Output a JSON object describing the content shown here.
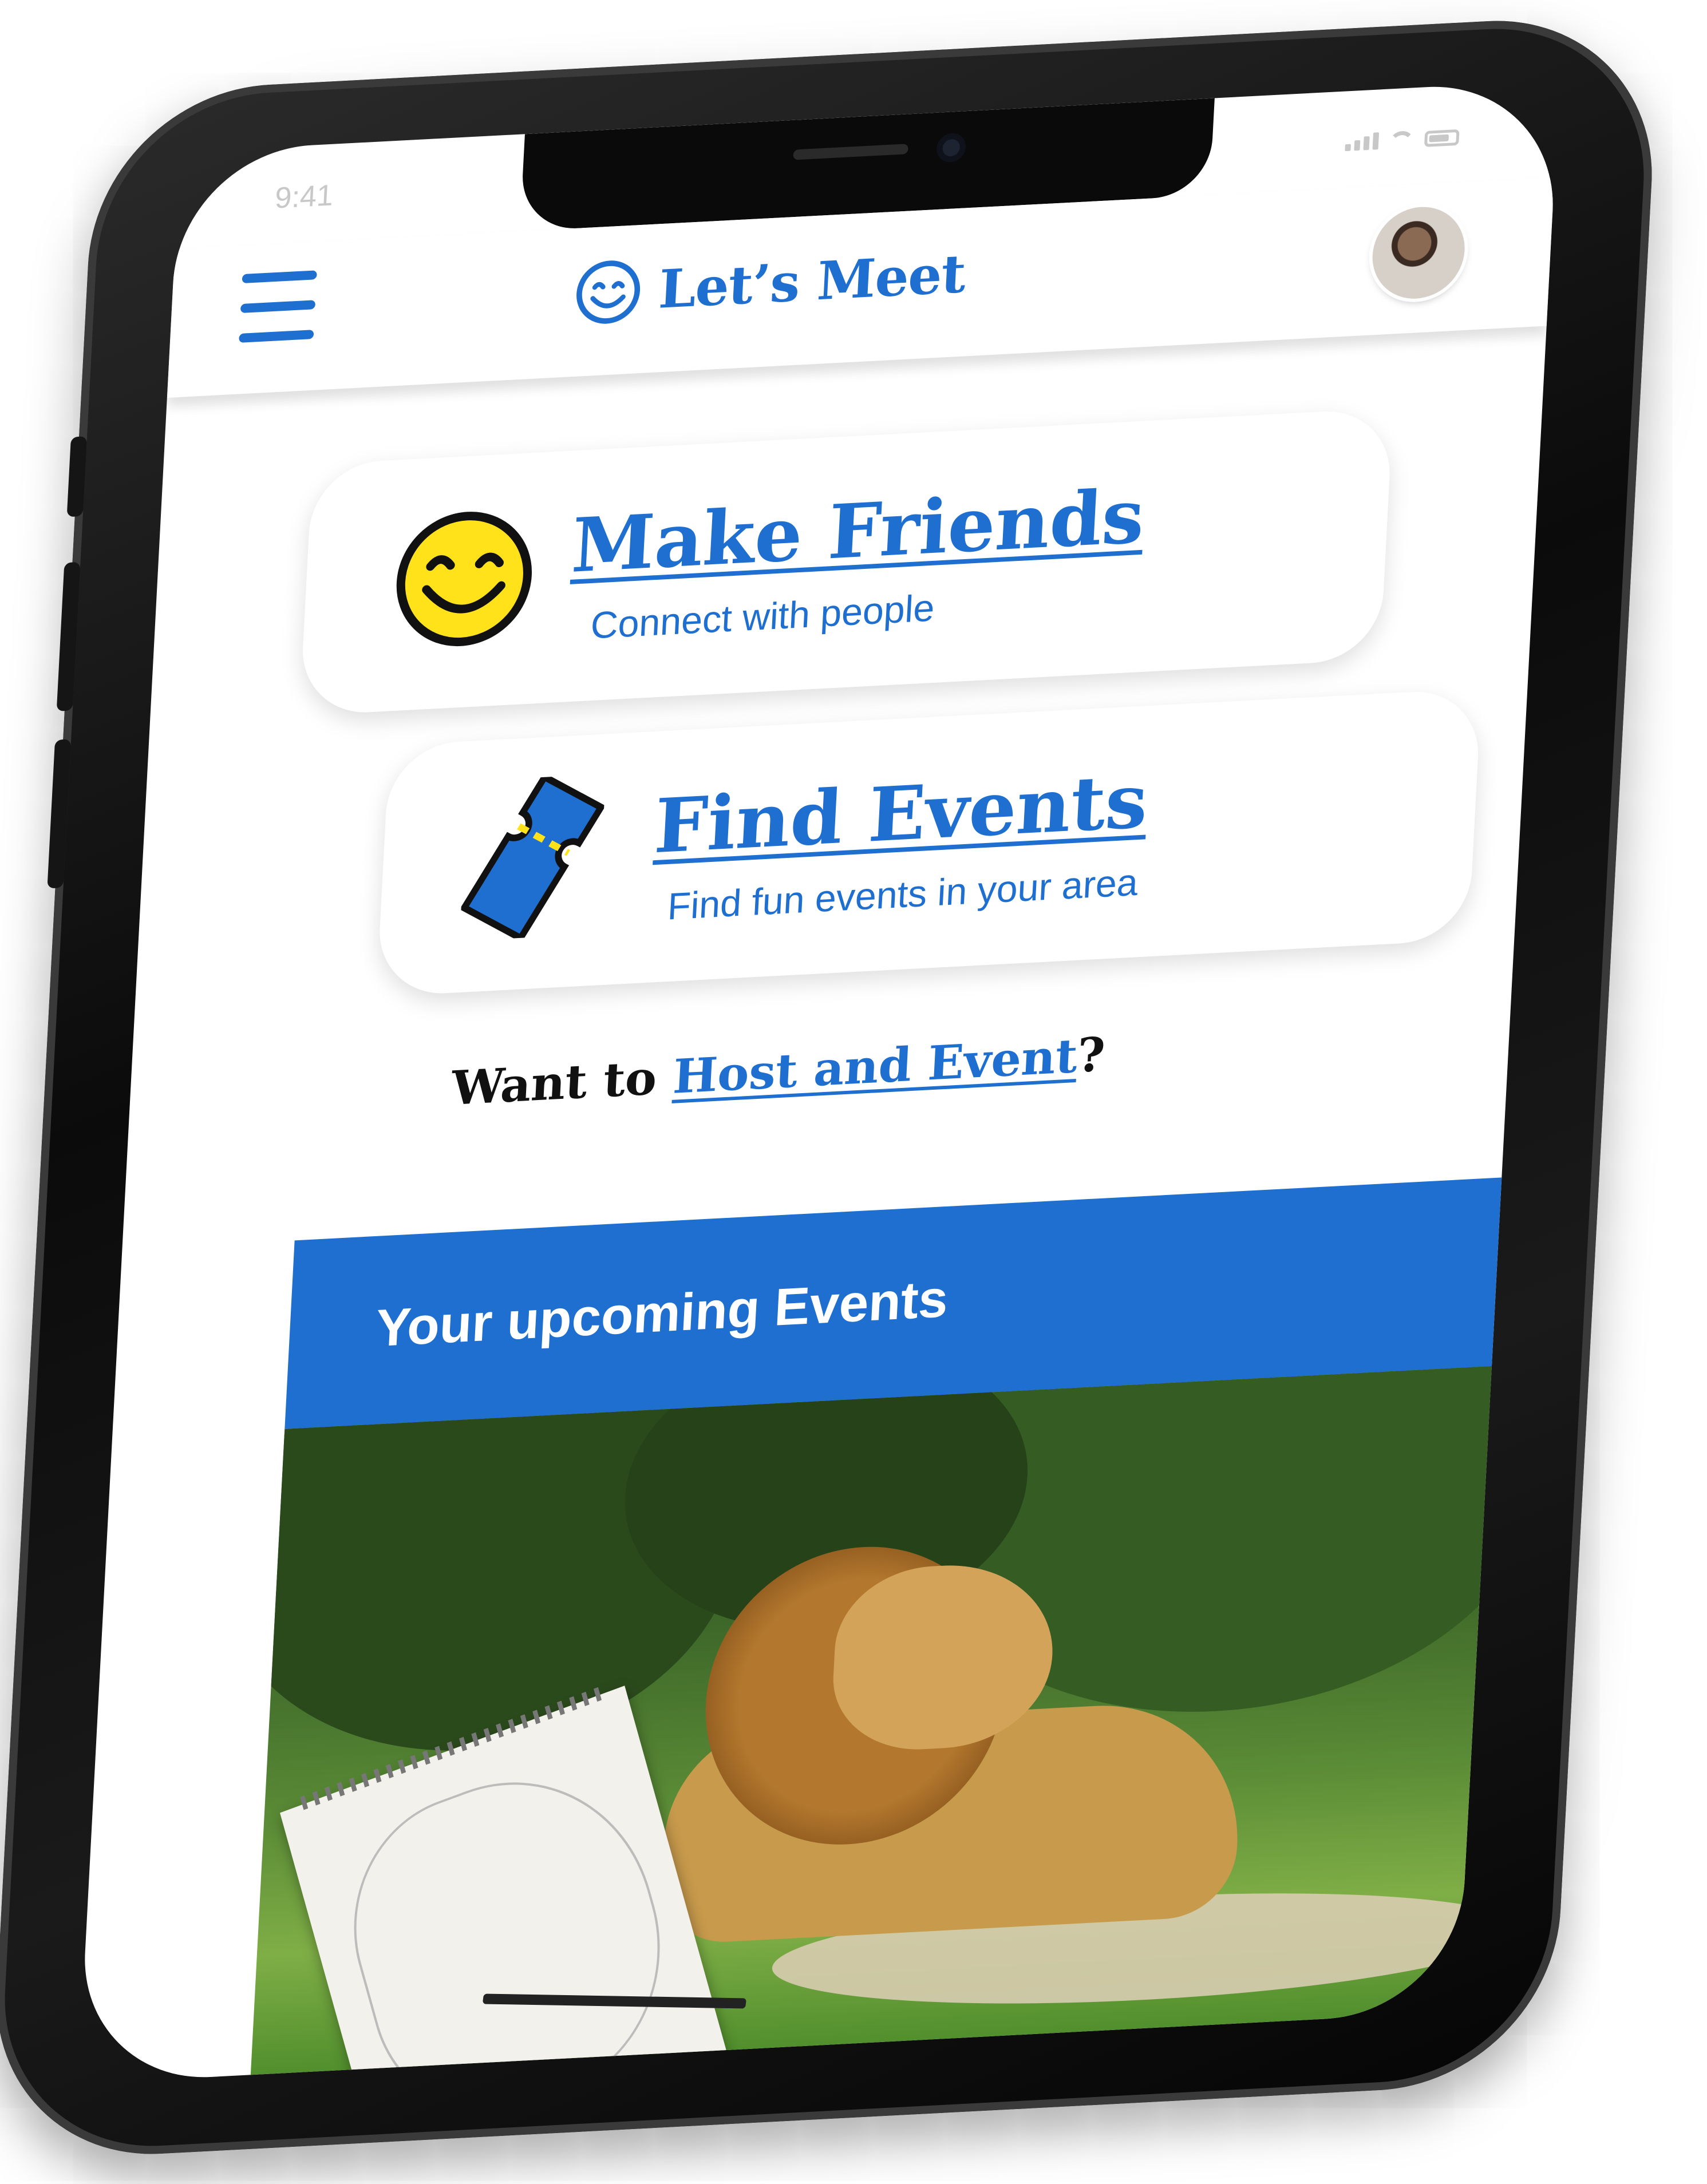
{
  "status_bar": {
    "time": "9:41"
  },
  "header": {
    "app_name": "Let’s Meet"
  },
  "cards": {
    "make_friends": {
      "title": "Make Friends",
      "subtitle": "Connect with people"
    },
    "find_events": {
      "title": "Find Events",
      "subtitle": "Find fun events in your area"
    }
  },
  "host": {
    "prefix": "Want to ",
    "link": "Host and Event",
    "suffix": "?"
  },
  "upcoming": {
    "title": "Your upcoming Events"
  },
  "colors": {
    "accent": "#1f6fd1",
    "banner": "#1e6fd0",
    "smiley": "#ffe21a",
    "text_dark": "#111111"
  },
  "icons": {
    "menu": "hamburger-icon",
    "brand": "smiley-icon",
    "make_friends": "smiley-face-icon",
    "find_events": "ticket-icon"
  }
}
